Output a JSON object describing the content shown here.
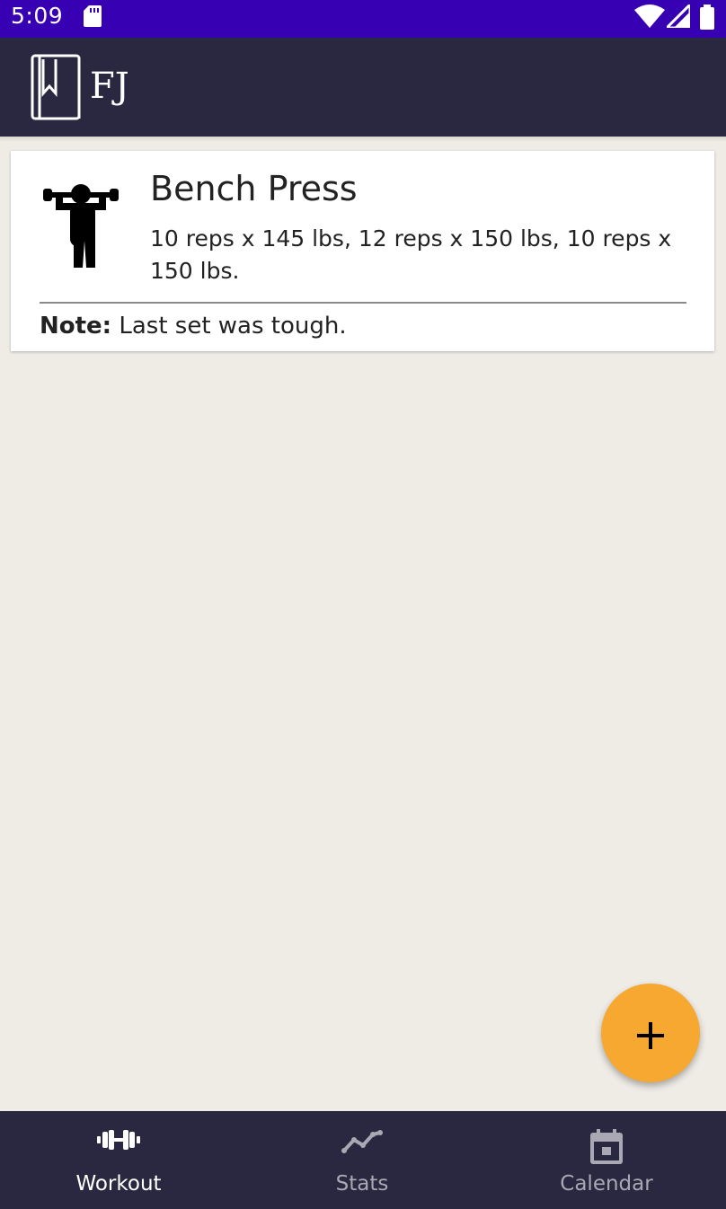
{
  "status_bar": {
    "time": "5:09",
    "icons": [
      "sd-card-icon",
      "wifi-icon",
      "signal-icon",
      "battery-icon"
    ]
  },
  "app_bar": {
    "logo_text": "FJ",
    "logo_icon": "book-icon"
  },
  "workout_entries": [
    {
      "icon": "weightlifter-icon",
      "exercise": "Bench Press",
      "sets": "10 reps x 145 lbs, 12 reps x 150 lbs, 10 reps x 150 lbs.",
      "note_label": "Note:",
      "note_text": " Last set was tough."
    }
  ],
  "fab": {
    "label": "+",
    "icon": "add-icon"
  },
  "bottom_nav": {
    "items": [
      {
        "label": "Workout",
        "icon": "dumbbell-icon",
        "active": true
      },
      {
        "label": "Stats",
        "icon": "line-chart-icon",
        "active": false
      },
      {
        "label": "Calendar",
        "icon": "calendar-icon",
        "active": false
      }
    ]
  },
  "colors": {
    "status_bar": "#3700b3",
    "app_bar": "#2a2840",
    "background": "#efece6",
    "fab": "#f6a830",
    "nav_active": "#ffffff",
    "nav_inactive": "#a9a8b3"
  }
}
